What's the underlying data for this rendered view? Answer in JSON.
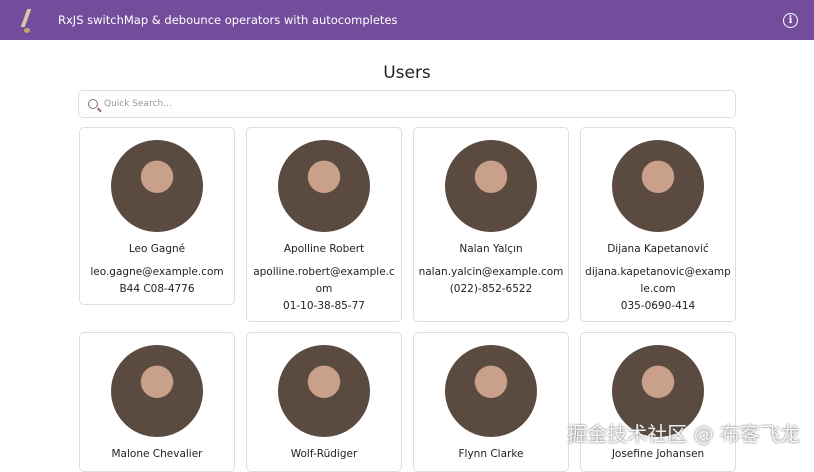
{
  "header": {
    "title": "RxJS switchMap & debounce operators with autocompletes",
    "info_icon": "i"
  },
  "page_title": "Users",
  "search": {
    "placeholder": "Quick Search...",
    "value": ""
  },
  "users": [
    {
      "name": "Leo Gagné",
      "email": "leo.gagne@example.com",
      "phone": "B44 C08-4776"
    },
    {
      "name": "Apolline Robert",
      "email": "apolline.robert@example.com",
      "phone": "01-10-38-85-77"
    },
    {
      "name": "Nalan Yalçın",
      "email": "nalan.yalcin@example.com",
      "phone": "(022)-852-6522"
    },
    {
      "name": "Dijana Kapetanović",
      "email": "dijana.kapetanovic@example.com",
      "phone": "035-0690-414"
    },
    {
      "name": "Malone Chevalier"
    },
    {
      "name": "Wolf-Rüdiger"
    },
    {
      "name": "Flynn Clarke"
    },
    {
      "name": "Josefine Johansen"
    }
  ],
  "watermark": "掘金技术社区 @ 布客飞龙"
}
